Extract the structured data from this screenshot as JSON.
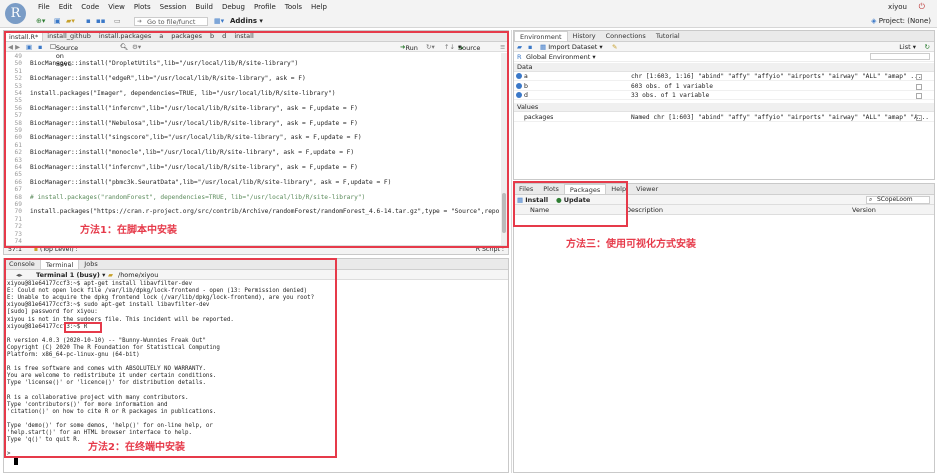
{
  "app": {
    "menu": [
      "File",
      "Edit",
      "Code",
      "View",
      "Plots",
      "Session",
      "Build",
      "Debug",
      "Profile",
      "Tools",
      "Help"
    ],
    "user": "xiyou",
    "toolbar": {
      "goto_placeholder": "Go to file/funct",
      "addins": "Addins",
      "project": "Project: (None)"
    }
  },
  "source": {
    "tabs": [
      "install.R*",
      "install_github",
      "install.packages",
      "a",
      "packages",
      "b",
      "d",
      "install"
    ],
    "tools": {
      "source_on_save": "Source on Save",
      "run": "Run",
      "source": "Source"
    },
    "lines": [
      {
        "n": "49",
        "t": ""
      },
      {
        "n": "50",
        "t": "BiocManager::install(\"DropletUtils\",lib=\"/usr/local/lib/R/site-library\")"
      },
      {
        "n": "51",
        "t": ""
      },
      {
        "n": "52",
        "t": "BiocManager::install(\"edgeR\",lib=\"/usr/local/lib/R/site-library\", ask = F)"
      },
      {
        "n": "53",
        "t": ""
      },
      {
        "n": "54",
        "t": "install.packages(\"Imager\", dependencies=TRUE, lib=\"/usr/local/lib/R/site-library\")"
      },
      {
        "n": "55",
        "t": ""
      },
      {
        "n": "56",
        "t": "BiocManager::install(\"infercnv\",lib=\"/usr/local/lib/R/site-library\", ask = F,update = F)"
      },
      {
        "n": "57",
        "t": ""
      },
      {
        "n": "58",
        "t": "BiocManager::install(\"Nebulosa\",lib=\"/usr/local/lib/R/site-library\", ask = F,update = F)"
      },
      {
        "n": "59",
        "t": ""
      },
      {
        "n": "60",
        "t": "BiocManager::install(\"singscore\",lib=\"/usr/local/lib/R/site-library\", ask = F,update = F)"
      },
      {
        "n": "61",
        "t": ""
      },
      {
        "n": "62",
        "t": "BiocManager::install(\"monocle\",lib=\"/usr/local/lib/R/site-library\", ask = F,update = F)"
      },
      {
        "n": "63",
        "t": ""
      },
      {
        "n": "64",
        "t": "BiocManager::install(\"infercnv\",lib=\"/usr/local/lib/R/site-library\", ask = F,update = F)"
      },
      {
        "n": "65",
        "t": ""
      },
      {
        "n": "66",
        "t": "BiocManager::install(\"pbmc3k.SeuratData\",lib=\"/usr/local/lib/R/site-library\", ask = F,update = F)"
      },
      {
        "n": "67",
        "t": ""
      },
      {
        "n": "68",
        "t": "# install.packages(\"randomForest\", dependencies=TRUE, lib=\"/usr/local/lib/R/site-library\")"
      },
      {
        "n": "69",
        "t": ""
      },
      {
        "n": "70",
        "t": "install.packages(\"https://cran.r-project.org/src/contrib/Archive/randomForest/randomForest_4.6-14.tar.gz\",type = \"Source\",repo"
      },
      {
        "n": "71",
        "t": ""
      },
      {
        "n": "72",
        "t": ""
      },
      {
        "n": "73",
        "t": ""
      },
      {
        "n": "74",
        "t": ""
      }
    ],
    "status_pos": "57:1",
    "status_level": "(Top Level) :",
    "status_type": "R Script :"
  },
  "environment": {
    "tabs": [
      "Environment",
      "History",
      "Connections",
      "Tutorial"
    ],
    "import": "Import Dataset",
    "list": "List",
    "scope": "Global Environment",
    "sections": {
      "data": "Data",
      "values": "Values"
    },
    "data_rows": [
      {
        "name": "a",
        "value": "chr [1:603, 1:16] \"abind\" \"affy\" \"affyio\" \"airports\" \"airway\" \"ALL\" \"amap\" ..."
      },
      {
        "name": "b",
        "value": "603 obs. of 1 variable"
      },
      {
        "name": "d",
        "value": "33 obs. of 1 variable"
      }
    ],
    "value_rows": [
      {
        "name": "packages",
        "value": "Named chr [1:603] \"abind\" \"affy\" \"affyio\" \"airports\" \"airway\" \"ALL\" \"amap\" \"A..."
      }
    ]
  },
  "packages": {
    "tabs": [
      "Files",
      "Plots",
      "Packages",
      "Help",
      "Viewer"
    ],
    "install": "Install",
    "update": "Update",
    "search": "SCopeLoom",
    "columns": [
      "Name",
      "Description",
      "Version"
    ]
  },
  "console": {
    "tabs": [
      "Console",
      "Terminal",
      "Jobs"
    ],
    "terminal_label": "Terminal 1 (busy)",
    "path": "/home/xiyou",
    "lines": [
      "xiyou@81e64177ccf3:~$ apt-get install libavfilter-dev",
      "E: Could not open lock file /var/lib/dpkg/lock-frontend - open (13: Permission denied)",
      "E: Unable to acquire the dpkg frontend lock (/var/lib/dpkg/lock-frontend), are you root?",
      "xiyou@81e64177ccf3:~$ sudo apt-get install libavfilter-dev",
      "[sudo] password for xiyou:",
      "xiyou is not in the sudoers file.  This incident will be reported.",
      "xiyou@81e64177ccf3:~$ R",
      "",
      "R version 4.0.3 (2020-10-10) -- \"Bunny-Wunnies Freak Out\"",
      "Copyright (C) 2020 The R Foundation for Statistical Computing",
      "Platform: x86_64-pc-linux-gnu (64-bit)",
      "",
      "R is free software and comes with ABSOLUTELY NO WARRANTY.",
      "You are welcome to redistribute it under certain conditions.",
      "Type 'license()' or 'licence()' for distribution details.",
      "",
      "R is a collaborative project with many contributors.",
      "Type 'contributors()' for more information and",
      "'citation()' on how to cite R or R packages in publications.",
      "",
      "Type 'demo()' for some demos, 'help()' for on-line help, or",
      "'help.start()' for an HTML browser interface to help.",
      "Type 'q()' to quit R.",
      "",
      "> "
    ]
  },
  "annotations": {
    "method1": "方法1：在脚本中安装",
    "method2": "方法2：在终端中安装",
    "method3": "方法三：使用可视化方式安装"
  },
  "colors": {
    "annotation_red": "#e63a4a",
    "r_logo": "#7a9cc6"
  }
}
